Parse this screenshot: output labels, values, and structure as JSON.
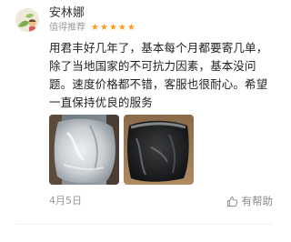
{
  "reviewer": {
    "name": "安林娜",
    "recommend_label": "值得推荐",
    "rating": 5,
    "star_color": "#ff9a1f"
  },
  "review": {
    "lines": [
      "用君丰好几年了，基本每个月都要寄几单，",
      "除了当地国家的不可抗力因素，基本没问",
      "题。速度价格都不错，客服也很耐心。希望",
      "一直保持优良的服务"
    ]
  },
  "photos": [
    {
      "icon": "package-photo-light"
    },
    {
      "icon": "package-photo-dark"
    }
  ],
  "footer": {
    "date": "4月5日",
    "helpful_label": "有帮助",
    "helpful_icon": "thumbs-up-icon"
  }
}
